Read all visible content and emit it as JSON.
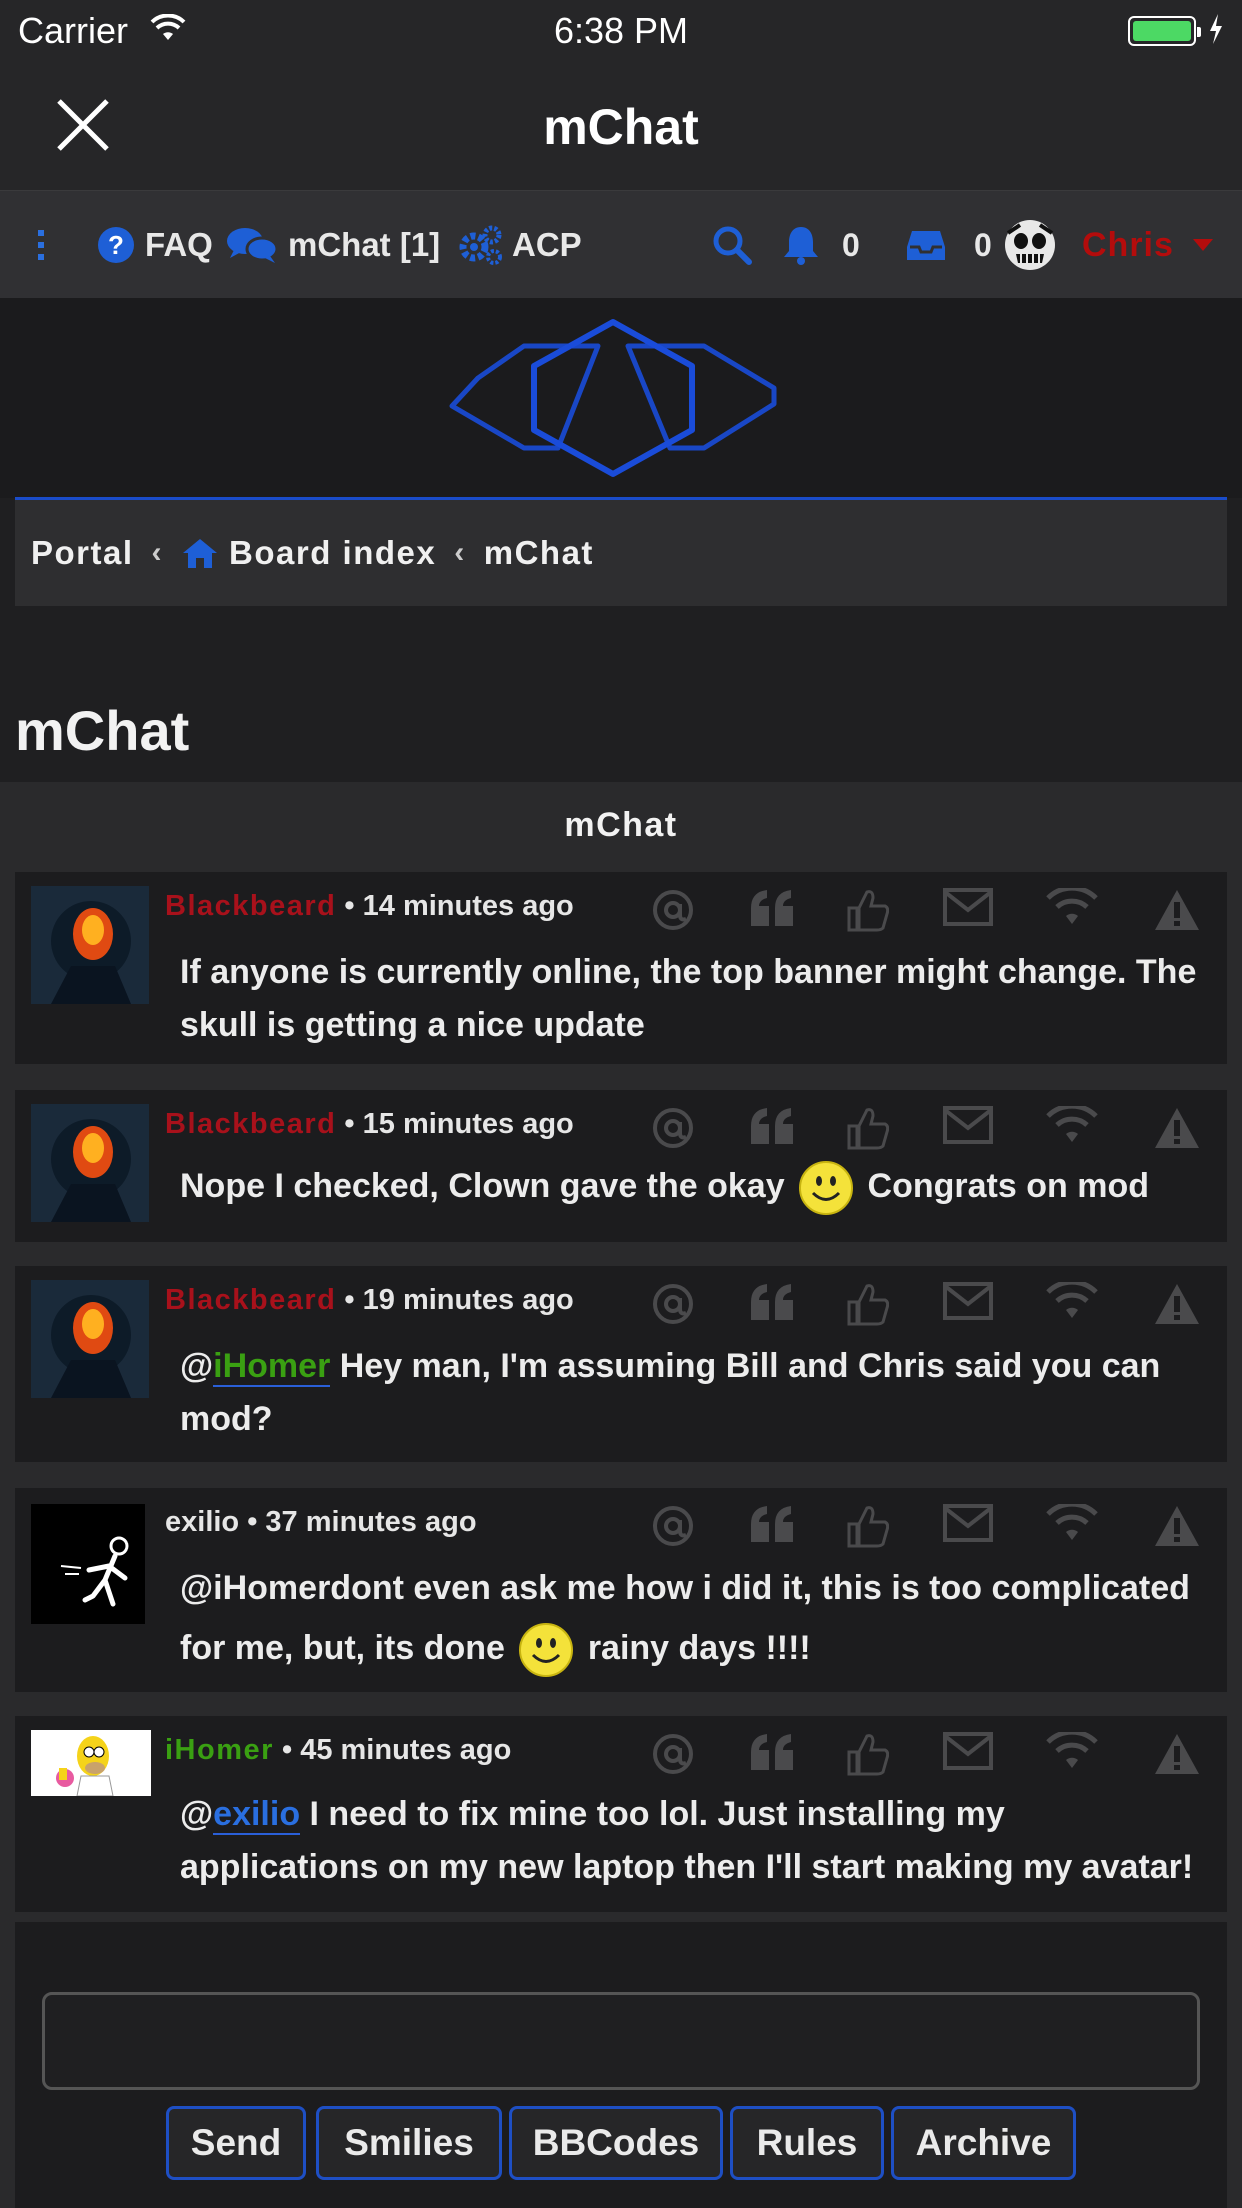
{
  "status_bar": {
    "carrier": "Carrier",
    "time": "6:38 PM"
  },
  "nav": {
    "title": "mChat"
  },
  "menu": {
    "faq": "FAQ",
    "mchat": "mChat [1]",
    "acp": "ACP",
    "notifications_count": "0",
    "inbox_count": "0",
    "username": "Chris"
  },
  "breadcrumb": {
    "portal": "Portal",
    "board_index": "Board index",
    "current": "mChat",
    "sep": "‹"
  },
  "page": {
    "title": "mChat",
    "panel_title": "mChat"
  },
  "messages": [
    {
      "author": "Blackbeard",
      "time": "• 14 minutes ago",
      "text": "If anyone is currently online, the top banner might change. The skull is getting a nice update"
    },
    {
      "author": "Blackbeard",
      "time": "• 15 minutes ago",
      "text_before": "Nope I checked, Clown gave the okay",
      "text_after": "Congrats on mod"
    },
    {
      "author": "Blackbeard",
      "time": "• 19 minutes ago",
      "mention_prefix": "@",
      "mention": "iHomer",
      "text": " Hey man, I'm assuming Bill and Chris said you can mod?"
    },
    {
      "author": "exilio",
      "time": "• 37 minutes ago",
      "text_before": "@iHomerdont even ask me how i did it, this is too complicated for me, but, its done",
      "text_after": "rainy days !!!!"
    },
    {
      "author": "iHomer",
      "time": "• 45 minutes ago",
      "mention_prefix": "@",
      "mention": "exilio",
      "text": " I need to fix mine too lol. Just installing my applications on my new laptop then I'll start making my avatar!"
    }
  ],
  "buttons": {
    "send": "Send",
    "smilies": "Smilies",
    "bbcodes": "BBCodes",
    "rules": "Rules",
    "archive": "Archive"
  },
  "colors": {
    "accent": "#1a4cc9",
    "admin_red": "#a8111b",
    "mod_green": "#3aa012"
  }
}
